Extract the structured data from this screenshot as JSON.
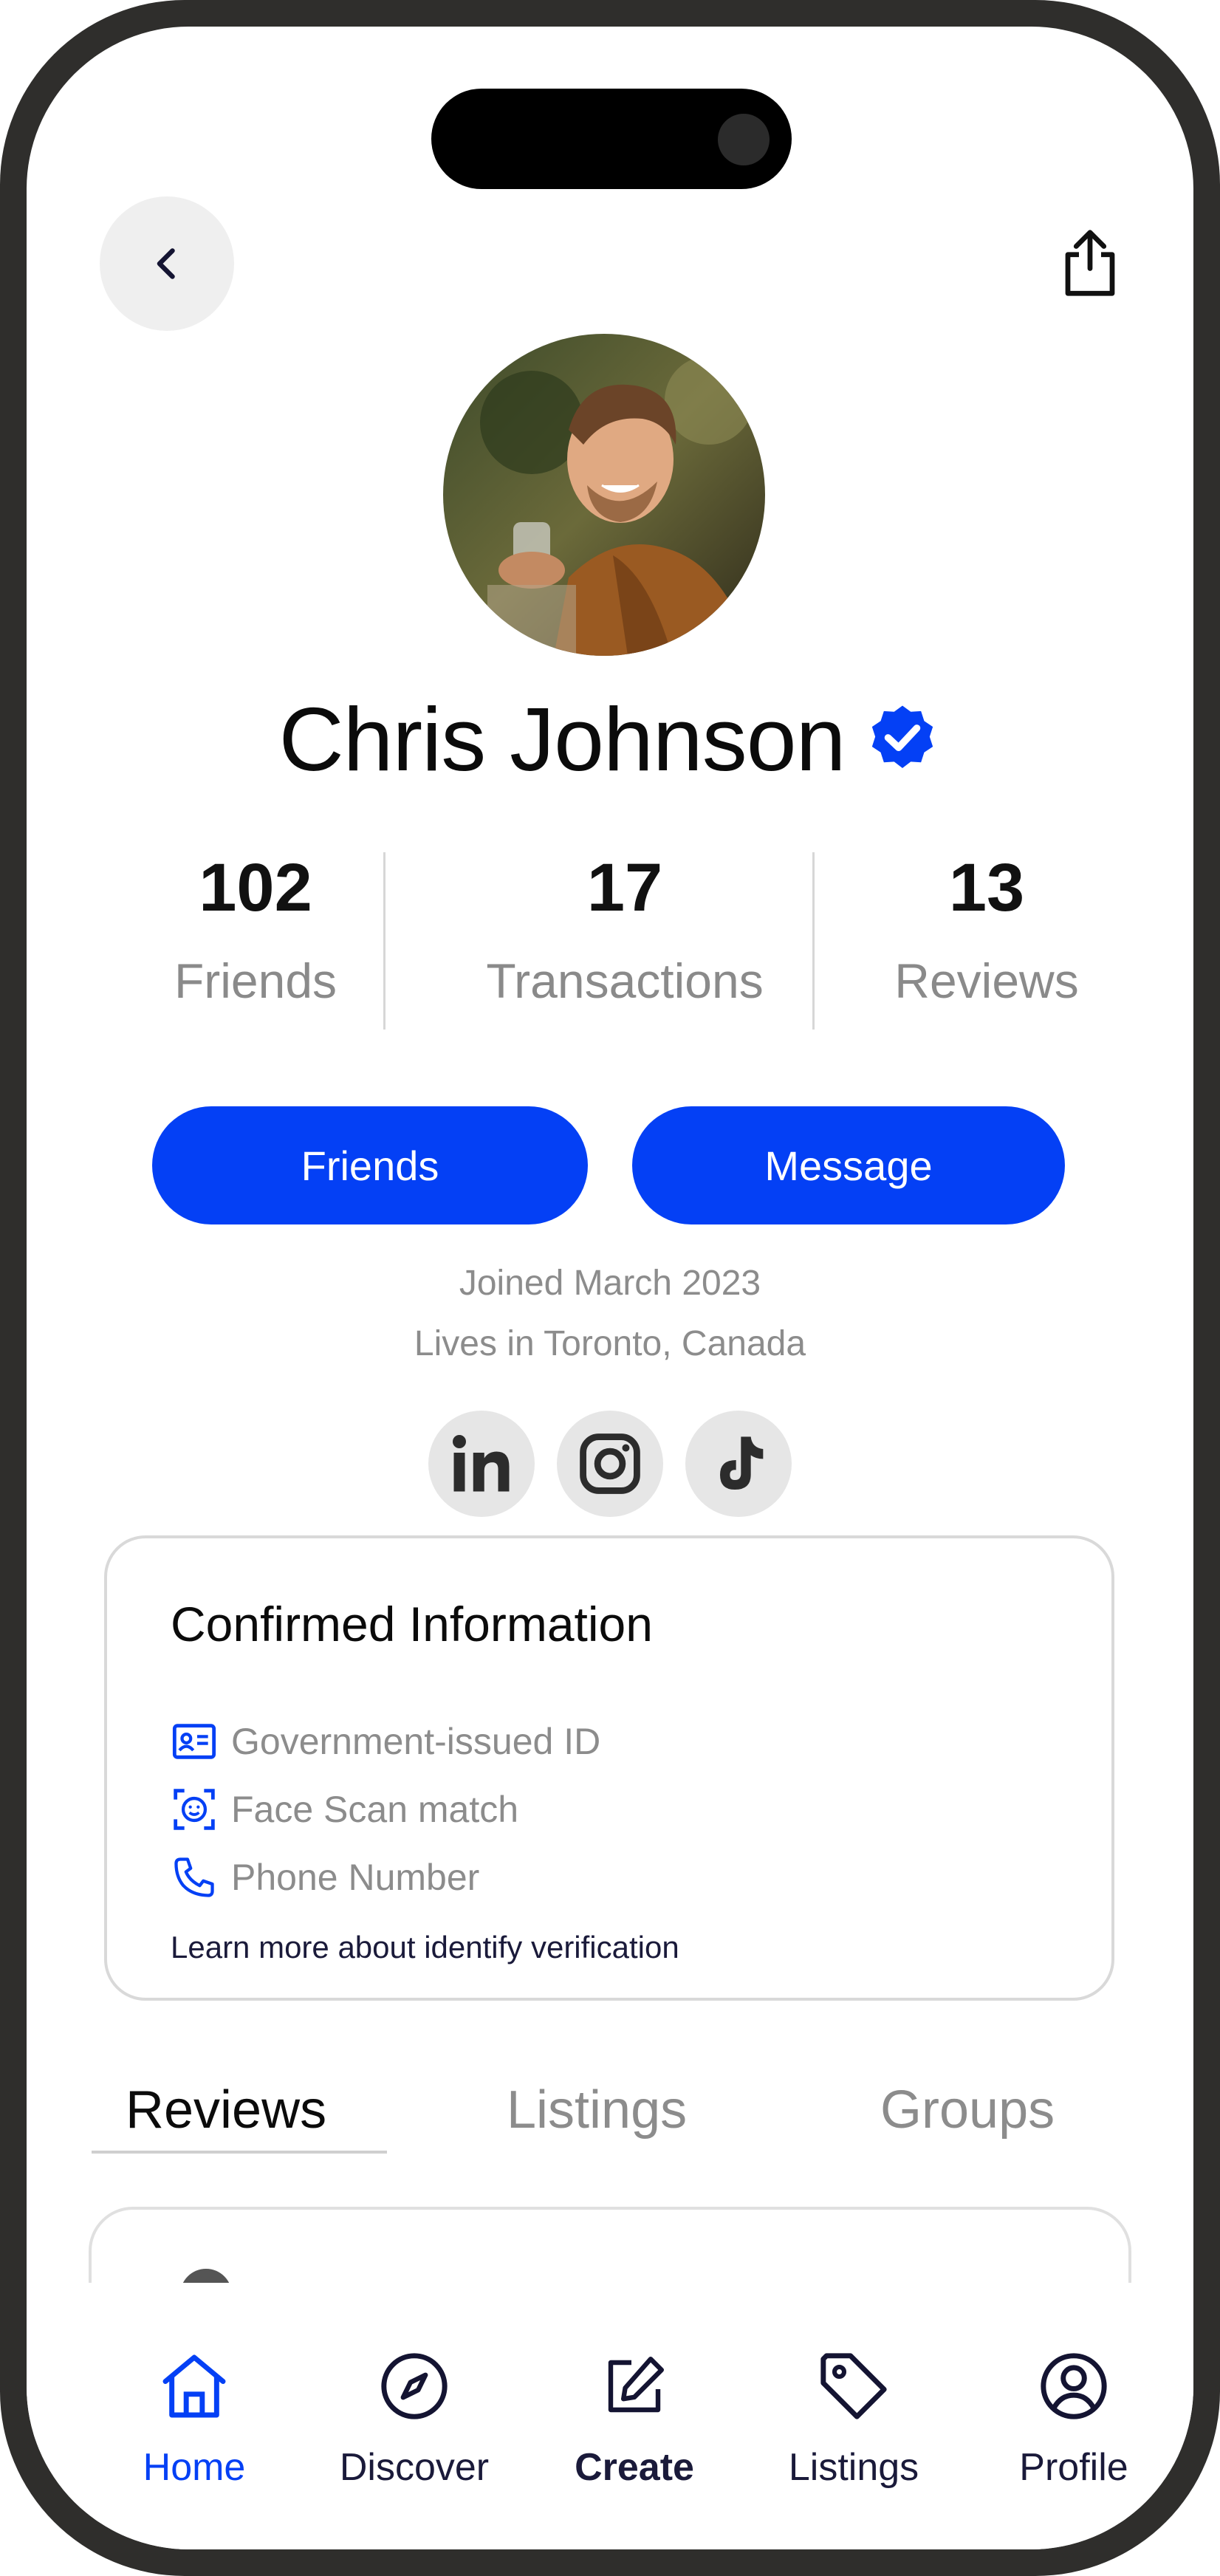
{
  "header": {
    "back_icon": "chevron-left-icon",
    "share_icon": "share-icon"
  },
  "profile": {
    "name": "Chris Johnson",
    "verified_icon": "verified-badge-icon",
    "accent_color": "#0440f5",
    "stats": [
      {
        "value": "102",
        "label": "Friends"
      },
      {
        "value": "17",
        "label": "Transactions"
      },
      {
        "value": "13",
        "label": "Reviews"
      }
    ],
    "buttons": {
      "friends": "Friends",
      "message": "Message"
    },
    "joined": "Joined March 2023",
    "location": "Lives in Toronto, Canada",
    "social": [
      "linkedin-icon",
      "instagram-icon",
      "tiktok-icon"
    ]
  },
  "confirmed": {
    "title": "Confirmed Information",
    "items": [
      {
        "icon": "id-card-icon",
        "label": "Government-issued ID"
      },
      {
        "icon": "face-scan-icon",
        "label": "Face Scan match"
      },
      {
        "icon": "phone-icon",
        "label": "Phone Number"
      }
    ],
    "link": "Learn more about identify verification"
  },
  "tabs": [
    "Reviews",
    "Listings",
    "Groups"
  ],
  "nav": [
    {
      "label": "Home",
      "icon": "home-icon"
    },
    {
      "label": "Discover",
      "icon": "compass-icon"
    },
    {
      "label": "Create",
      "icon": "edit-icon"
    },
    {
      "label": "Listings",
      "icon": "tag-icon"
    },
    {
      "label": "Profile",
      "icon": "user-circle-icon"
    }
  ]
}
